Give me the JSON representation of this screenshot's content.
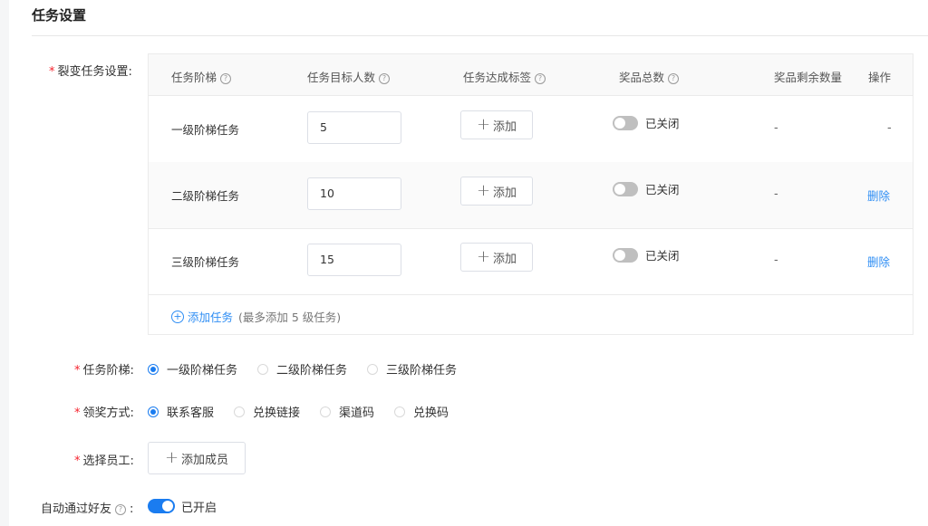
{
  "section": {
    "title": "任务设置"
  },
  "task_setting": {
    "required_mark": "*",
    "label": "裂变任务设置:",
    "columns": {
      "tier": "任务阶梯",
      "target": "任务目标人数",
      "tag": "任务达成标签",
      "prize_total": "奖品总数",
      "prize_remaining": "奖品剩余数量",
      "action": "操作"
    },
    "help_glyph": "?",
    "rows": [
      {
        "name": "一级阶梯任务",
        "target": "5",
        "tag_button": "添加",
        "prize_status": "已关闭",
        "remaining": "-",
        "action": "-"
      },
      {
        "name": "二级阶梯任务",
        "target": "10",
        "tag_button": "添加",
        "prize_status": "已关闭",
        "remaining": "-",
        "action": "删除"
      },
      {
        "name": "三级阶梯任务",
        "target": "15",
        "tag_button": "添加",
        "prize_status": "已关闭",
        "remaining": "-",
        "action": "删除"
      }
    ],
    "add_task": {
      "label": "添加任务",
      "note": "(最多添加 5 级任务)"
    }
  },
  "tier_select": {
    "label": "任务阶梯:",
    "options": [
      "一级阶梯任务",
      "二级阶梯任务",
      "三级阶梯任务"
    ],
    "selected": "一级阶梯任务"
  },
  "reward_method": {
    "label": "领奖方式:",
    "options": [
      "联系客服",
      "兑换链接",
      "渠道码",
      "兑换码"
    ],
    "selected": "联系客服"
  },
  "staff": {
    "label": "选择员工:",
    "button": "添加成员"
  },
  "auto_accept": {
    "label": "自动通过好友",
    "colon": ":",
    "status": "已开启",
    "enabled": true
  },
  "colors": {
    "accent": "#1a7cf0",
    "required": "#f5222d",
    "link": "#2f8ef4"
  }
}
